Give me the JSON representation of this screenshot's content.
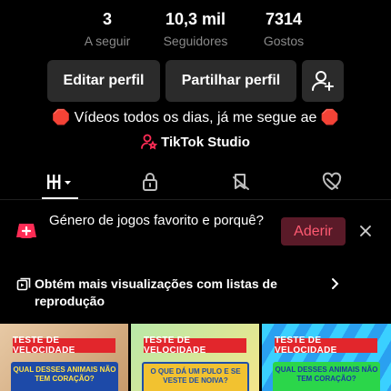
{
  "stats": {
    "following": {
      "value": "3",
      "label": "A seguir"
    },
    "followers": {
      "value": "10,3 mil",
      "label": "Seguidores"
    },
    "likes": {
      "value": "7314",
      "label": "Gostos"
    }
  },
  "buttons": {
    "edit_profile": "Editar perfil",
    "share_profile": "Partilhar perfil"
  },
  "bio": "🛑 Vídeos todos os dias, já me segue ae 🛑",
  "studio_label": "TikTok Studio",
  "prompt": {
    "text": "Género de jogos favorito e porquê?",
    "join_label": "Aderir"
  },
  "playlists_text": "Obtém mais visualizações com listas de reprodução",
  "videos": [
    {
      "tag": "TESTE DE VELOCIDADE",
      "question": "QUAL DESSES ANIMAIS NÃO TEM CORAÇÃO?"
    },
    {
      "tag": "TESTE DE VELOCIDADE",
      "question": "O QUE DÁ UM PULO E SE VESTE DE NOIVA?"
    },
    {
      "tag": "TESTE DE VELOCIDADE",
      "question": "QUAL DESSES ANIMAIS NÃO TEM CORAÇÃO?"
    }
  ],
  "colors": {
    "accent": "#fe2c55",
    "join_bg": "#5a1a28",
    "button_bg": "#2b2b2b"
  },
  "icons": {
    "add_friend": "person-plus-icon",
    "studio": "person-star-icon",
    "videos_tab": "grid-bars-icon",
    "private_tab": "lock-icon",
    "reposts_tab": "bookmark-slash-icon",
    "liked_tab": "heart-slash-icon",
    "prompt": "gamepad-plus-icon",
    "close": "close-icon",
    "playlist": "playlist-icon",
    "chevron": "chevron-right-icon"
  }
}
